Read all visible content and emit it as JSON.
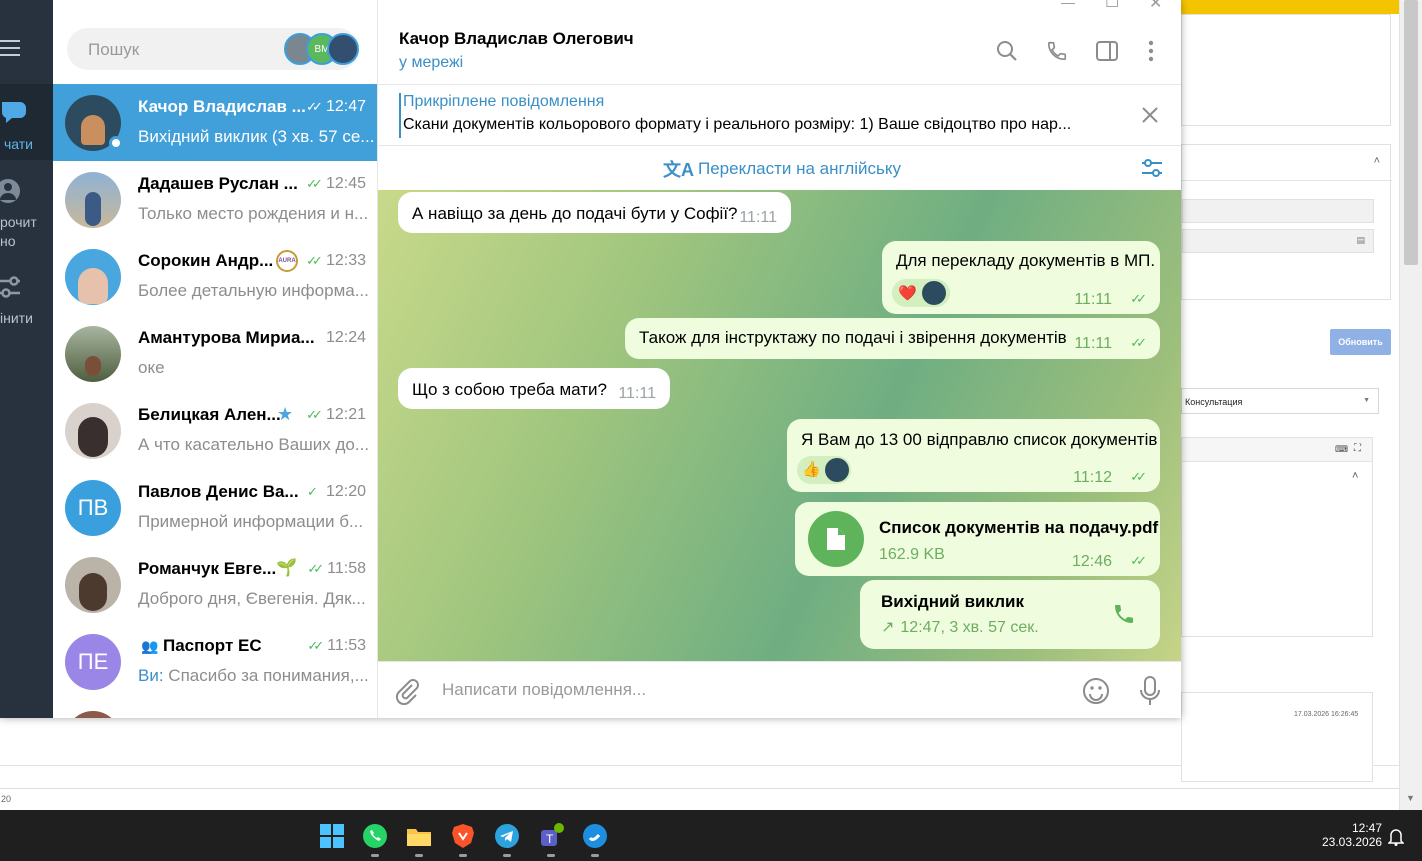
{
  "window_controls": {
    "minimize": "—",
    "maximize": "☐",
    "close": "✕"
  },
  "rail": {
    "chats_label": "чати",
    "unread_label_1": "рочит",
    "unread_label_2": "но",
    "edit_label": "інити"
  },
  "search": {
    "placeholder": "Пошук",
    "avatar_badge": "ВМ"
  },
  "chats": [
    {
      "name": "Качор Владислав ...",
      "time": "12:47",
      "preview": "Вихідний виклик (3 хв. 57 се...",
      "selected": true,
      "avatar_color": "#2d4b5f"
    },
    {
      "name": "Дадашев Руслан ...",
      "time": "12:45",
      "preview": "Только место рождения и н...",
      "avatar_color": "#8fa7c4"
    },
    {
      "name": "Сорокин Андр...",
      "time": "12:33",
      "preview": "Более детальную информа...",
      "avatar_color": "#6fb8e6",
      "badge": "AURA"
    },
    {
      "name": "Амантурова Мириа...",
      "time": "12:24",
      "preview": "оке",
      "avatar_color": "#6b7a5a"
    },
    {
      "name": "Белицкая Ален...",
      "time": "12:21",
      "preview": "А что касательно Ваших до...",
      "avatar_color": "#3a2f2f"
    },
    {
      "name": "Павлов Денис Ва...",
      "time": "12:20",
      "preview": "Примерной информации б...",
      "initials": "ПВ",
      "avatar_color": "#3aa0dd"
    },
    {
      "name": "Романчук Евге...",
      "time": "11:58",
      "preview": "Доброго дня, Євегенія. Дяк...",
      "avatar_color": "#4c5b3d"
    },
    {
      "name": "Паспорт ЕС",
      "time": "11:53",
      "preview_prefix": "Ви:",
      "preview": " Спасибо за понимания,...",
      "initials": "ПЕ",
      "avatar_color": "#9a86e6"
    }
  ],
  "header": {
    "name": "Качор Владислав Олегович",
    "status": "у мережі"
  },
  "pinned": {
    "title": "Прикріплене повідомлення",
    "text": "Скани документів кольорового формату і реального розміру: 1) Ваше свідоцтво про нар..."
  },
  "translate": {
    "label": "Перекласти на англійську"
  },
  "messages": [
    {
      "dir": "in",
      "text": "А навіщо за день до подачі бути у Софії?",
      "time": "11:11"
    },
    {
      "dir": "out",
      "text": "Для перекладу документів в МП.",
      "time": "11:11",
      "reaction": "❤️"
    },
    {
      "dir": "out",
      "text": "Також для інструктажу по подачі і звірення документів",
      "time": "11:11"
    },
    {
      "dir": "in",
      "text": "Що з собою треба мати?",
      "time": "11:11"
    },
    {
      "dir": "out",
      "text": "Я Вам до 13 00 відправлю список документів",
      "time": "11:12",
      "reaction": "👍"
    },
    {
      "dir": "out",
      "file_name": "Список документів на подачу.pdf",
      "file_size": "162.9 KB",
      "time": "12:46"
    },
    {
      "dir": "out",
      "call_title": "Вихідний виклик",
      "call_info": "12:47, 3 хв. 57 сек."
    }
  ],
  "compose": {
    "placeholder": "Написати повідомлення..."
  },
  "background_page": {
    "button": "Обновить",
    "select_value": "Консультация",
    "timestamp": "17.03.2026 16:26:45",
    "footer": "20"
  },
  "taskbar": {
    "time": "12:47",
    "date": "23.03.2026",
    "apps": [
      "windows-start",
      "whatsapp",
      "file-explorer",
      "brave",
      "telegram",
      "teams",
      "skype"
    ]
  },
  "colors": {
    "accent": "#419fd9",
    "check": "#4dbb5b",
    "rail": "#28323e",
    "outgoing": "#effdde"
  }
}
